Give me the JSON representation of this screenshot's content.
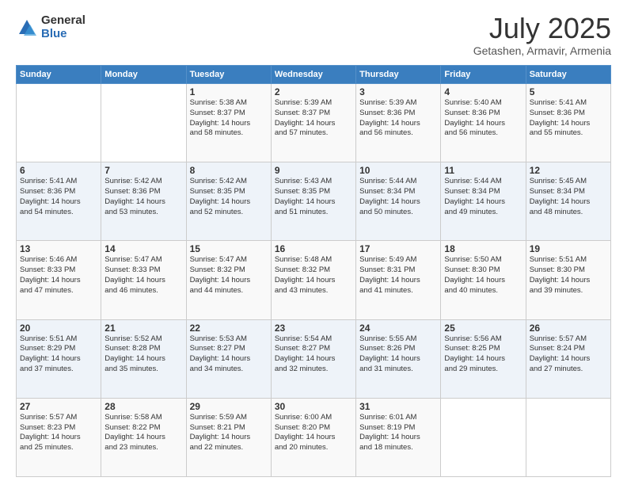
{
  "logo": {
    "general": "General",
    "blue": "Blue"
  },
  "header": {
    "month": "July 2025",
    "location": "Getashen, Armavir, Armenia"
  },
  "weekdays": [
    "Sunday",
    "Monday",
    "Tuesday",
    "Wednesday",
    "Thursday",
    "Friday",
    "Saturday"
  ],
  "weeks": [
    [
      {
        "day": "",
        "info": ""
      },
      {
        "day": "",
        "info": ""
      },
      {
        "day": "1",
        "info": "Sunrise: 5:38 AM\nSunset: 8:37 PM\nDaylight: 14 hours\nand 58 minutes."
      },
      {
        "day": "2",
        "info": "Sunrise: 5:39 AM\nSunset: 8:37 PM\nDaylight: 14 hours\nand 57 minutes."
      },
      {
        "day": "3",
        "info": "Sunrise: 5:39 AM\nSunset: 8:36 PM\nDaylight: 14 hours\nand 56 minutes."
      },
      {
        "day": "4",
        "info": "Sunrise: 5:40 AM\nSunset: 8:36 PM\nDaylight: 14 hours\nand 56 minutes."
      },
      {
        "day": "5",
        "info": "Sunrise: 5:41 AM\nSunset: 8:36 PM\nDaylight: 14 hours\nand 55 minutes."
      }
    ],
    [
      {
        "day": "6",
        "info": "Sunrise: 5:41 AM\nSunset: 8:36 PM\nDaylight: 14 hours\nand 54 minutes."
      },
      {
        "day": "7",
        "info": "Sunrise: 5:42 AM\nSunset: 8:36 PM\nDaylight: 14 hours\nand 53 minutes."
      },
      {
        "day": "8",
        "info": "Sunrise: 5:42 AM\nSunset: 8:35 PM\nDaylight: 14 hours\nand 52 minutes."
      },
      {
        "day": "9",
        "info": "Sunrise: 5:43 AM\nSunset: 8:35 PM\nDaylight: 14 hours\nand 51 minutes."
      },
      {
        "day": "10",
        "info": "Sunrise: 5:44 AM\nSunset: 8:34 PM\nDaylight: 14 hours\nand 50 minutes."
      },
      {
        "day": "11",
        "info": "Sunrise: 5:44 AM\nSunset: 8:34 PM\nDaylight: 14 hours\nand 49 minutes."
      },
      {
        "day": "12",
        "info": "Sunrise: 5:45 AM\nSunset: 8:34 PM\nDaylight: 14 hours\nand 48 minutes."
      }
    ],
    [
      {
        "day": "13",
        "info": "Sunrise: 5:46 AM\nSunset: 8:33 PM\nDaylight: 14 hours\nand 47 minutes."
      },
      {
        "day": "14",
        "info": "Sunrise: 5:47 AM\nSunset: 8:33 PM\nDaylight: 14 hours\nand 46 minutes."
      },
      {
        "day": "15",
        "info": "Sunrise: 5:47 AM\nSunset: 8:32 PM\nDaylight: 14 hours\nand 44 minutes."
      },
      {
        "day": "16",
        "info": "Sunrise: 5:48 AM\nSunset: 8:32 PM\nDaylight: 14 hours\nand 43 minutes."
      },
      {
        "day": "17",
        "info": "Sunrise: 5:49 AM\nSunset: 8:31 PM\nDaylight: 14 hours\nand 41 minutes."
      },
      {
        "day": "18",
        "info": "Sunrise: 5:50 AM\nSunset: 8:30 PM\nDaylight: 14 hours\nand 40 minutes."
      },
      {
        "day": "19",
        "info": "Sunrise: 5:51 AM\nSunset: 8:30 PM\nDaylight: 14 hours\nand 39 minutes."
      }
    ],
    [
      {
        "day": "20",
        "info": "Sunrise: 5:51 AM\nSunset: 8:29 PM\nDaylight: 14 hours\nand 37 minutes."
      },
      {
        "day": "21",
        "info": "Sunrise: 5:52 AM\nSunset: 8:28 PM\nDaylight: 14 hours\nand 35 minutes."
      },
      {
        "day": "22",
        "info": "Sunrise: 5:53 AM\nSunset: 8:27 PM\nDaylight: 14 hours\nand 34 minutes."
      },
      {
        "day": "23",
        "info": "Sunrise: 5:54 AM\nSunset: 8:27 PM\nDaylight: 14 hours\nand 32 minutes."
      },
      {
        "day": "24",
        "info": "Sunrise: 5:55 AM\nSunset: 8:26 PM\nDaylight: 14 hours\nand 31 minutes."
      },
      {
        "day": "25",
        "info": "Sunrise: 5:56 AM\nSunset: 8:25 PM\nDaylight: 14 hours\nand 29 minutes."
      },
      {
        "day": "26",
        "info": "Sunrise: 5:57 AM\nSunset: 8:24 PM\nDaylight: 14 hours\nand 27 minutes."
      }
    ],
    [
      {
        "day": "27",
        "info": "Sunrise: 5:57 AM\nSunset: 8:23 PM\nDaylight: 14 hours\nand 25 minutes."
      },
      {
        "day": "28",
        "info": "Sunrise: 5:58 AM\nSunset: 8:22 PM\nDaylight: 14 hours\nand 23 minutes."
      },
      {
        "day": "29",
        "info": "Sunrise: 5:59 AM\nSunset: 8:21 PM\nDaylight: 14 hours\nand 22 minutes."
      },
      {
        "day": "30",
        "info": "Sunrise: 6:00 AM\nSunset: 8:20 PM\nDaylight: 14 hours\nand 20 minutes."
      },
      {
        "day": "31",
        "info": "Sunrise: 6:01 AM\nSunset: 8:19 PM\nDaylight: 14 hours\nand 18 minutes."
      },
      {
        "day": "",
        "info": ""
      },
      {
        "day": "",
        "info": ""
      }
    ]
  ]
}
